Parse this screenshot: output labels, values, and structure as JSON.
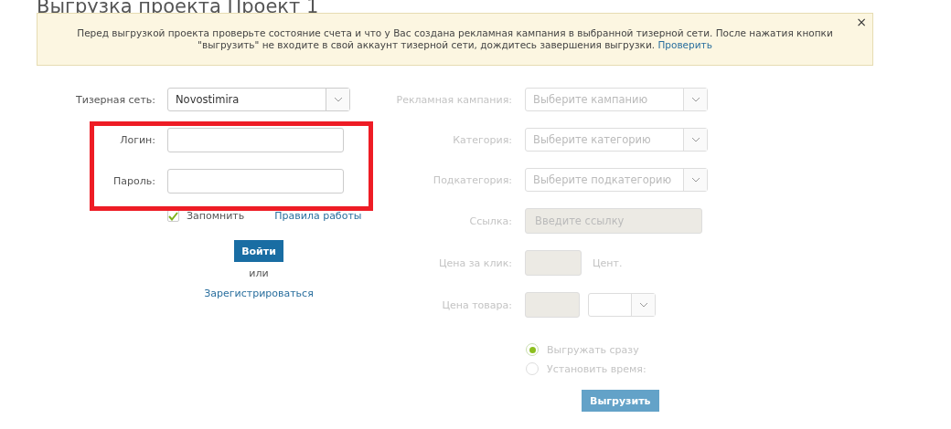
{
  "page_title": "Выгрузка проекта Проект 1",
  "alert": {
    "text": "Перед выгрузкой проекта проверьте состояние счета и что у Вас создана рекламная кампания в выбранной тизерной сети. После нажатия кнопки \"выгрузить\" не входите в свой аккаунт тизерной сети, дождитесь завершения выгрузки.",
    "link": "Проверить",
    "close": "×"
  },
  "login_form": {
    "highlighted": true,
    "network": {
      "label": "Тизерная сеть:",
      "value": "Novostimira"
    },
    "fields": [
      {
        "label": "Логин:"
      },
      {
        "label": "Пароль:"
      }
    ],
    "remember": {
      "label": "Запомнить",
      "checked": true
    },
    "rules_link": "Правила работы",
    "login_button": "Войти",
    "or": "или",
    "register_link": "Зарегистрироваться"
  },
  "export_form": {
    "disabled": true,
    "rows": [
      {
        "kind": "select",
        "label": "Рекламная кампания:",
        "placeholder": "Выберите кампанию"
      },
      {
        "kind": "select",
        "label": "Категория:",
        "placeholder": "Выберите категорию"
      },
      {
        "kind": "select",
        "label": "Подкатегория:",
        "placeholder": "Выберите подкатегорию"
      },
      {
        "kind": "text",
        "label": "Ссылка:",
        "placeholder": "Введите ссылку"
      },
      {
        "kind": "price",
        "label": "Цена за клик:",
        "unit": "Цент."
      },
      {
        "kind": "price-select",
        "label": "Цена товара:"
      }
    ],
    "schedule": [
      {
        "label": "Выгружать сразу",
        "selected": true
      },
      {
        "label": "Установить время:",
        "selected": false
      }
    ],
    "export_button": "Выгрузить"
  }
}
